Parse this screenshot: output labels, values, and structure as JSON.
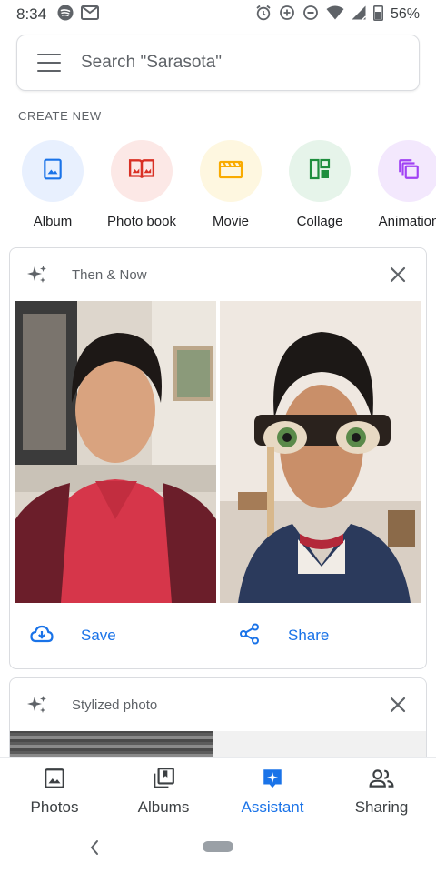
{
  "status_bar": {
    "time": "8:34",
    "battery": "56%"
  },
  "search": {
    "placeholder": "Search \"Sarasota\""
  },
  "create_new": {
    "label": "CREATE NEW",
    "items": [
      {
        "label": "Album",
        "icon": "album-icon",
        "bg": "#e8f0fe",
        "color": "#1a73e8"
      },
      {
        "label": "Photo book",
        "icon": "photo-book-icon",
        "bg": "#fce8e6",
        "color": "#d93025"
      },
      {
        "label": "Movie",
        "icon": "movie-icon",
        "bg": "#fef7e0",
        "color": "#f9ab00"
      },
      {
        "label": "Collage",
        "icon": "collage-icon",
        "bg": "#e6f4ea",
        "color": "#1e8e3e"
      },
      {
        "label": "Animation",
        "icon": "animation-icon",
        "bg": "#f3e8fd",
        "color": "#a142f4"
      }
    ]
  },
  "cards": {
    "then_now": {
      "title": "Then & Now",
      "save_label": "Save",
      "share_label": "Share"
    },
    "stylized": {
      "title": "Stylized photo"
    }
  },
  "bottom_nav": {
    "items": [
      {
        "label": "Photos",
        "icon": "photos-icon",
        "active": false
      },
      {
        "label": "Albums",
        "icon": "albums-icon",
        "active": false
      },
      {
        "label": "Assistant",
        "icon": "assistant-icon",
        "active": true
      },
      {
        "label": "Sharing",
        "icon": "sharing-icon",
        "active": false
      }
    ]
  },
  "colors": {
    "accent": "#1a73e8",
    "text_secondary": "#5f6368",
    "border": "#dadce0"
  }
}
